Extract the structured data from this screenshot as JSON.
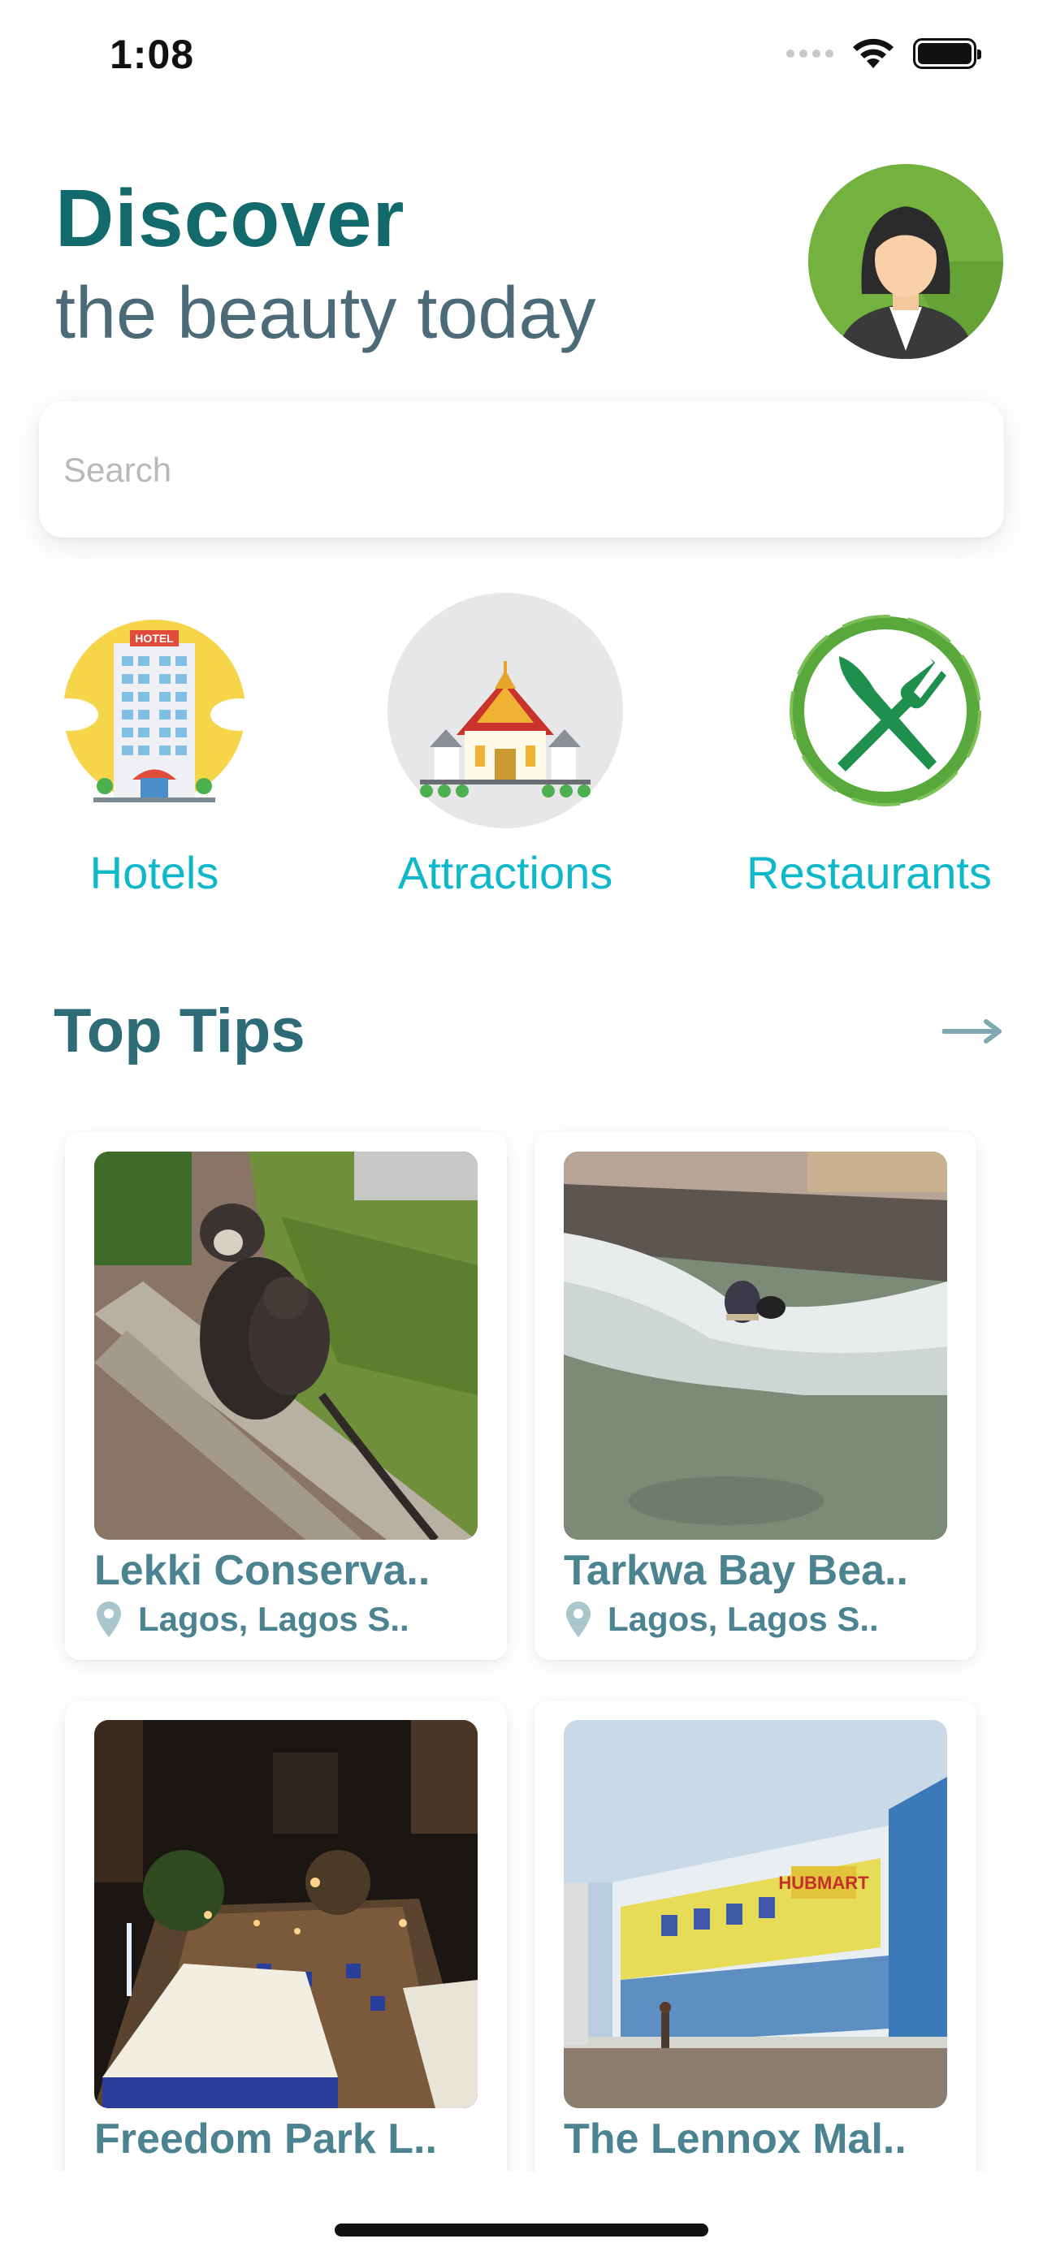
{
  "status_bar": {
    "time": "1:08",
    "icons": [
      "cellular-dots-icon",
      "wifi-icon",
      "battery-icon"
    ]
  },
  "header": {
    "title": "Discover",
    "subtitle": "the beauty today",
    "avatar_icon": "businesswoman-avatar"
  },
  "search": {
    "placeholder": "Search",
    "value": ""
  },
  "categories": [
    {
      "label": "Hotels",
      "icon": "hotel-building-icon"
    },
    {
      "label": "Attractions",
      "icon": "temple-icon"
    },
    {
      "label": "Restaurants",
      "icon": "fork-knife-icon"
    }
  ],
  "top_tips": {
    "title": "Top Tips",
    "more_icon": "arrow-right-icon"
  },
  "cards": [
    {
      "title": "Lekki Conserva..",
      "location": "Lagos, Lagos S..",
      "image": "monkeys-photo"
    },
    {
      "title": "Tarkwa Bay Bea..",
      "location": "Lagos, Lagos S..",
      "image": "surfer-photo"
    },
    {
      "title": "Freedom Park L..",
      "location": "",
      "image": "night-park-photo"
    },
    {
      "title": "The Lennox Mal..",
      "location": "",
      "image": "mall-photo"
    }
  ],
  "colors": {
    "title": "#136a6c",
    "subtitle": "#4d6a78",
    "category_label": "#0fb8c9",
    "section_title": "#2d6b76",
    "card_text": "#4c8390"
  }
}
